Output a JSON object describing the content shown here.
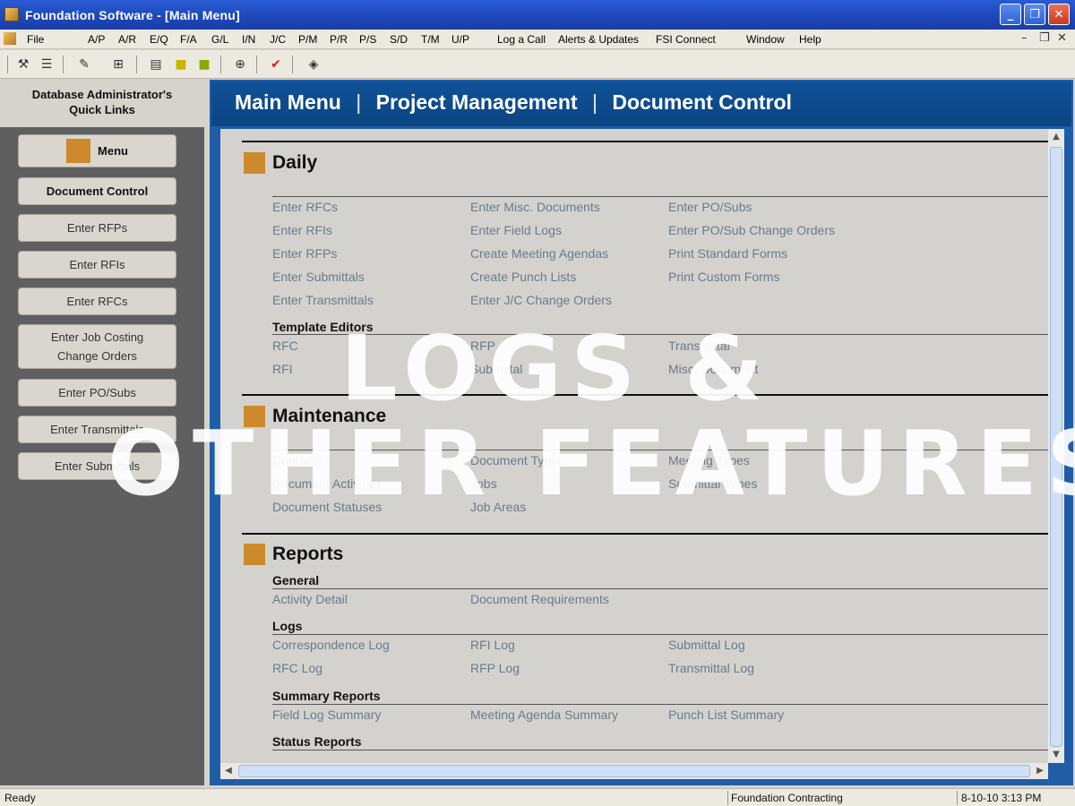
{
  "window": {
    "title": "Foundation Software - [Main Menu]",
    "controls": [
      "_",
      "❐",
      "✕"
    ]
  },
  "menubar": {
    "items": [
      "File",
      "A/P",
      "A/R",
      "E/Q",
      "F/A",
      "G/L",
      "I/N",
      "J/C",
      "P/M",
      "P/R",
      "P/S",
      "S/D",
      "T/M",
      "U/P",
      "Log a Call",
      "Alerts & Updates",
      "FSI Connect",
      "Window",
      "Help"
    ],
    "mdi_controls": [
      "–",
      "❐",
      "✕"
    ]
  },
  "toolbar": {
    "icons": [
      "hammer-icon",
      "list-icon",
      "pin-icon",
      "tree-icon",
      "doc-icon",
      "note-icon",
      "notes-icon",
      "target-icon",
      "check-icon",
      "signal-icon"
    ]
  },
  "left_panel": {
    "heading_line1": "Database Administrator's",
    "heading_line2": "Quick Links",
    "buttons": [
      {
        "label": "Menu"
      },
      {
        "label": "Document Control"
      },
      {
        "label": "Enter RFPs"
      },
      {
        "label": "Enter RFIs"
      },
      {
        "label": "Enter RFCs"
      },
      {
        "label_line1": "Enter Job Costing",
        "label_line2": "Change Orders"
      },
      {
        "label": "Enter PO/Subs"
      },
      {
        "label": "Enter Transmittals"
      },
      {
        "label": "Enter Submittals"
      }
    ]
  },
  "breadcrumb": {
    "part1": "Main Menu",
    "part2": "Project Management",
    "part3": "Document Control",
    "separator": "|"
  },
  "daily": {
    "title": "Daily",
    "col1": [
      "Enter RFCs",
      "Enter RFIs",
      "Enter RFPs",
      "Enter Submittals",
      "Enter Transmittals"
    ],
    "col2": [
      "Enter Misc. Documents",
      "Enter Field Logs",
      "Create Meeting Agendas",
      "Create Punch Lists",
      "Enter J/C Change Orders"
    ],
    "col3": [
      "Enter PO/Subs",
      "Enter PO/Sub Change Orders",
      "Print Standard Forms",
      "Print Custom Forms"
    ],
    "template_editors": {
      "title": "Template Editors",
      "items": [
        "RFC",
        "RFP",
        "Transmittal",
        "RFI",
        "Submittal",
        "Misc. Document"
      ]
    }
  },
  "maintenance": {
    "title": "Maintenance",
    "items": [
      "Contacts",
      "Document Types",
      "Meeting Types",
      "Document Activities",
      "Jobs",
      "Submittal Types",
      "Document Statuses",
      "Job Areas"
    ]
  },
  "reports": {
    "title": "Reports",
    "general": {
      "title": "General",
      "items": [
        "Activity Detail",
        "Document Requirements"
      ]
    },
    "logs": {
      "title": "Logs",
      "items": [
        "Correspondence Log",
        "RFI Log",
        "Submittal Log",
        "RFC Log",
        "RFP Log",
        "Transmittal Log"
      ]
    },
    "summary": {
      "title": "Summary Reports",
      "items": [
        "Field Log Summary",
        "Meeting Agenda Summary",
        "Punch List Summary"
      ]
    },
    "status": {
      "title": "Status Reports"
    }
  },
  "overlay": {
    "line1": "LOGS &",
    "line2": "OTHER FEATURES"
  },
  "statusbar": {
    "left": "Ready",
    "company": "Foundation Contracting",
    "datetime": "8-10-10 3:13 PM"
  }
}
